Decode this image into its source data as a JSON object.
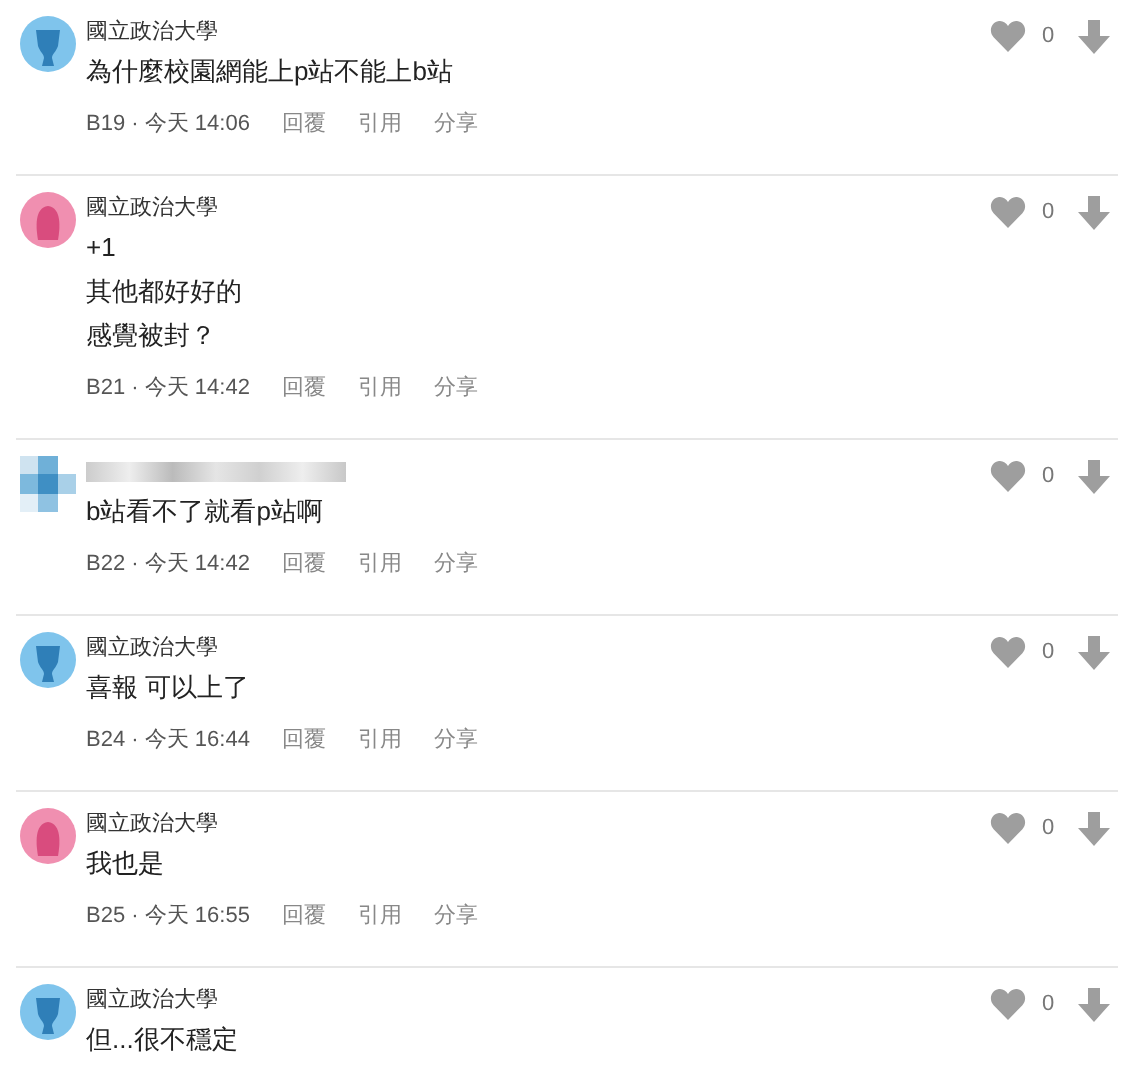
{
  "comments": [
    {
      "kind": "male",
      "name": "國立政治大學",
      "lines": [
        "為什麼校園網能上p站不能上b站"
      ],
      "meta": "B19 · 今天 14:06",
      "actions": [
        "回覆",
        "引用",
        "分享"
      ],
      "likes": "0"
    },
    {
      "kind": "female",
      "name": "國立政治大學",
      "lines": [
        "+1",
        "其他都好好的",
        "感覺被封？"
      ],
      "meta": "B21 · 今天 14:42",
      "actions": [
        "回覆",
        "引用",
        "分享"
      ],
      "likes": "0"
    },
    {
      "kind": "blurred",
      "lines": [
        "b站看不了就看p站啊"
      ],
      "meta": "B22 · 今天 14:42",
      "actions": [
        "回覆",
        "引用",
        "分享"
      ],
      "likes": "0"
    },
    {
      "kind": "male",
      "name": "國立政治大學",
      "lines": [
        "喜報 可以上了"
      ],
      "meta": "B24 · 今天 16:44",
      "actions": [
        "回覆",
        "引用",
        "分享"
      ],
      "likes": "0"
    },
    {
      "kind": "female",
      "name": "國立政治大學",
      "lines": [
        "我也是"
      ],
      "meta": "B25 · 今天 16:55",
      "actions": [
        "回覆",
        "引用",
        "分享"
      ],
      "likes": "0"
    },
    {
      "kind": "male",
      "name": "國立政治大學",
      "lines": [
        "但...很不穩定"
      ],
      "likes": "0"
    }
  ]
}
